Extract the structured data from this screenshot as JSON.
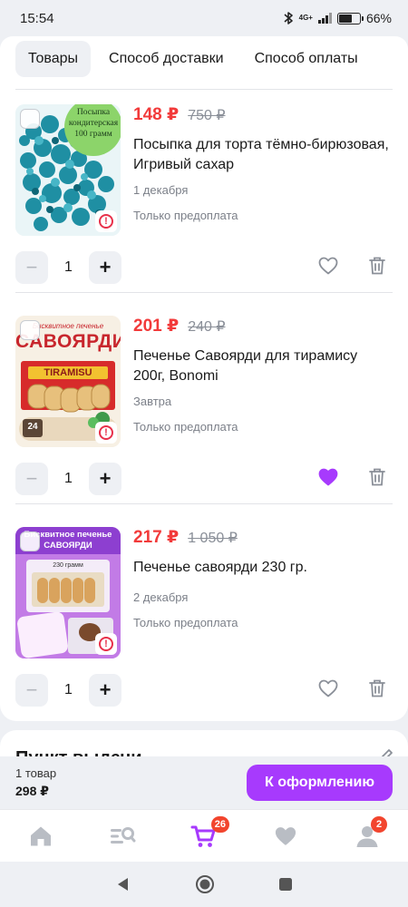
{
  "status_bar": {
    "time": "15:54",
    "network": "4G+",
    "battery": "66%",
    "battery_level": 0.66
  },
  "tabs": [
    {
      "label": "Товары",
      "active": true
    },
    {
      "label": "Способ доставки",
      "active": false
    },
    {
      "label": "Способ оплаты",
      "active": false
    }
  ],
  "items": [
    {
      "price_new": "148 ₽",
      "price_old": "750 ₽",
      "title": "Посыпка для торта тёмно-бирюзовая, Игривый сахар",
      "delivery": "1 декабря",
      "payment": "Только предоплата",
      "quantity": "1",
      "favorite": false,
      "image_caption": "Посыпка кондитерская 100 грамм"
    },
    {
      "price_new": "201 ₽",
      "price_old": "240 ₽",
      "title": "Печенье Савоярди для тирамису 200г, Bonomi",
      "delivery": "Завтра",
      "payment": "Только предоплата",
      "quantity": "1",
      "favorite": true,
      "image_caption_top": "Бисквитное печенье",
      "image_caption_brand": "САВОЯРДИ",
      "image_caption_pack": "TIRAMISU",
      "image_caption_count": "24"
    },
    {
      "price_new": "217 ₽",
      "price_old": "1 050 ₽",
      "title": "Печенье савоярди 230 гр.",
      "delivery": "2 декабря",
      "payment": "Только предоплата",
      "quantity": "1",
      "favorite": false,
      "image_caption_top": "Бисквитное печенье",
      "image_caption_brand": "САВОЯРДИ",
      "image_caption_weight": "230 грамм"
    }
  ],
  "pickup": {
    "title": "Пункт выдачи"
  },
  "checkout": {
    "count": "1 товар",
    "total": "298 ₽",
    "button": "К оформлению"
  },
  "bottom_nav": {
    "items": [
      {
        "icon": "home-icon",
        "badge": ""
      },
      {
        "icon": "catalog-search-icon",
        "badge": ""
      },
      {
        "icon": "cart-icon",
        "badge": "26"
      },
      {
        "icon": "heart-icon",
        "badge": ""
      },
      {
        "icon": "profile-icon",
        "badge": "2"
      }
    ]
  },
  "colors": {
    "accent": "#a73afd",
    "price": "#f23a3a",
    "badge": "#f2452e"
  }
}
